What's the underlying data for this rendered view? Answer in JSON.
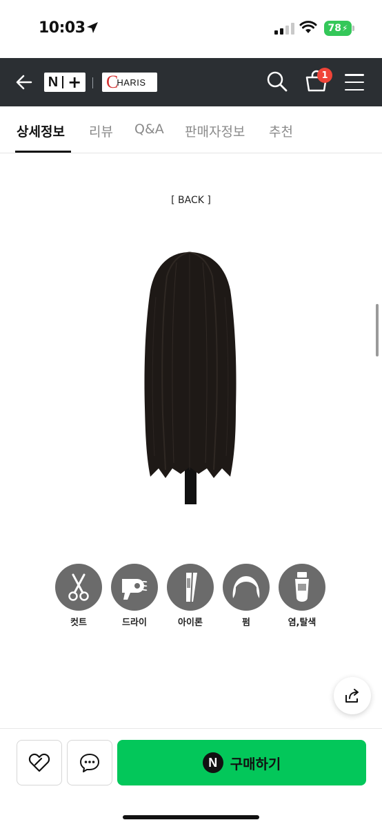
{
  "status_bar": {
    "time": "10:03",
    "battery": "78"
  },
  "header": {
    "logo_n": "N",
    "logo_plus": "+",
    "brand_c": "C",
    "brand_rest": "HARIS",
    "cart_count": "1"
  },
  "tabs": [
    {
      "label": "상세정보",
      "active": true
    },
    {
      "label": "리뷰"
    },
    {
      "label": "Q&A"
    },
    {
      "label": "판매자정보"
    },
    {
      "label": "추천"
    }
  ],
  "content": {
    "view_label": "[ BACK ]",
    "tools": [
      {
        "label": "컷트",
        "icon": "scissors-icon"
      },
      {
        "label": "드라이",
        "icon": "hair-dryer-icon"
      },
      {
        "label": "아이론",
        "icon": "flat-iron-icon"
      },
      {
        "label": "펌",
        "icon": "perm-icon"
      },
      {
        "label": "염,탈색",
        "icon": "dye-tube-icon"
      }
    ]
  },
  "bottom_bar": {
    "buy_n": "N",
    "buy_label": "구매하기"
  },
  "colors": {
    "header_bg": "#2b2f33",
    "buy_green": "#03c75a",
    "badge_red": "#f04438",
    "battery_green": "#34c759",
    "tool_gray": "#6b6b6b"
  }
}
